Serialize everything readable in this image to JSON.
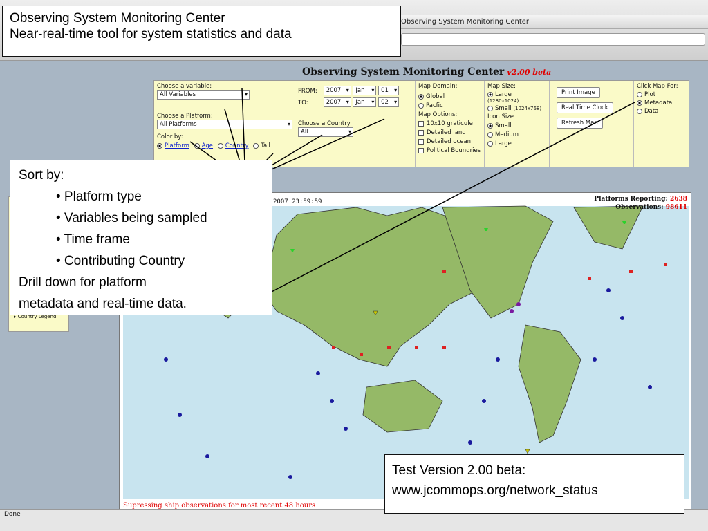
{
  "browser": {
    "window_title": "Observing System Monitoring Center",
    "status": "Done"
  },
  "site": {
    "title": "Observing System Monitoring Center",
    "version": "v2.00 beta"
  },
  "controls": {
    "variable_label": "Choose a variable:",
    "variable_value": "All Variables",
    "platform_label": "Choose a Platform:",
    "platform_value": "All Platforms",
    "colorby_label": "Color by:",
    "colorby_options": [
      "Platform",
      "Age",
      "Country",
      "Tail"
    ],
    "from_label": "FROM:",
    "from_year": "2007",
    "from_month": "Jan",
    "from_day": "01",
    "to_label": "TO:",
    "to_year": "2007",
    "to_month": "Jan",
    "to_day": "02",
    "country_label": "Choose a Country:",
    "country_value": "All",
    "domain_label": "Map Domain:",
    "domain_options": [
      "Global",
      "Pacfic"
    ],
    "options_label": "Map Options:",
    "map_options": [
      "10x10 graticule",
      "Detailed land",
      "Detailed ocean",
      "Political Boundries"
    ],
    "size_label": "Map Size:",
    "size_large": "Large",
    "size_large_dim": "(1280x1024)",
    "size_small": "Small",
    "size_small_dim": "(1024x768)",
    "icon_label": "Icon Size",
    "icon_options": [
      "Small",
      "Medium",
      "Large"
    ],
    "btn_print": "Print Image",
    "btn_clock": "Real Time Clock",
    "btn_refresh": "Refresh Map",
    "click_label": "Click Map For:",
    "click_options": [
      "Plot",
      "Metadata",
      "Data"
    ]
  },
  "legend": {
    "label": "Country Legend"
  },
  "map": {
    "timestamp": "2007 23:59:59",
    "platforms_label": "Platforms Reporting:",
    "platforms_value": "2638",
    "observations_label": "Observations:",
    "observations_value": "98611",
    "suppress_note": "Supressing ship observations for most recent 48 hours"
  },
  "callouts": {
    "title_line1": "Observing System Monitoring Center",
    "title_line2": "Near-real-time tool for system statistics and data",
    "sort_heading": "Sort by:",
    "sort_items": [
      "• Platform type",
      "• Variables being sampled",
      "• Time frame",
      "• Contributing Country"
    ],
    "drill_line1": "Drill down for platform",
    "drill_line2": "metadata and real-time data.",
    "test_line1": "Test Version 2.00 beta:",
    "test_line2": "www.jcommops.org/network_status"
  }
}
